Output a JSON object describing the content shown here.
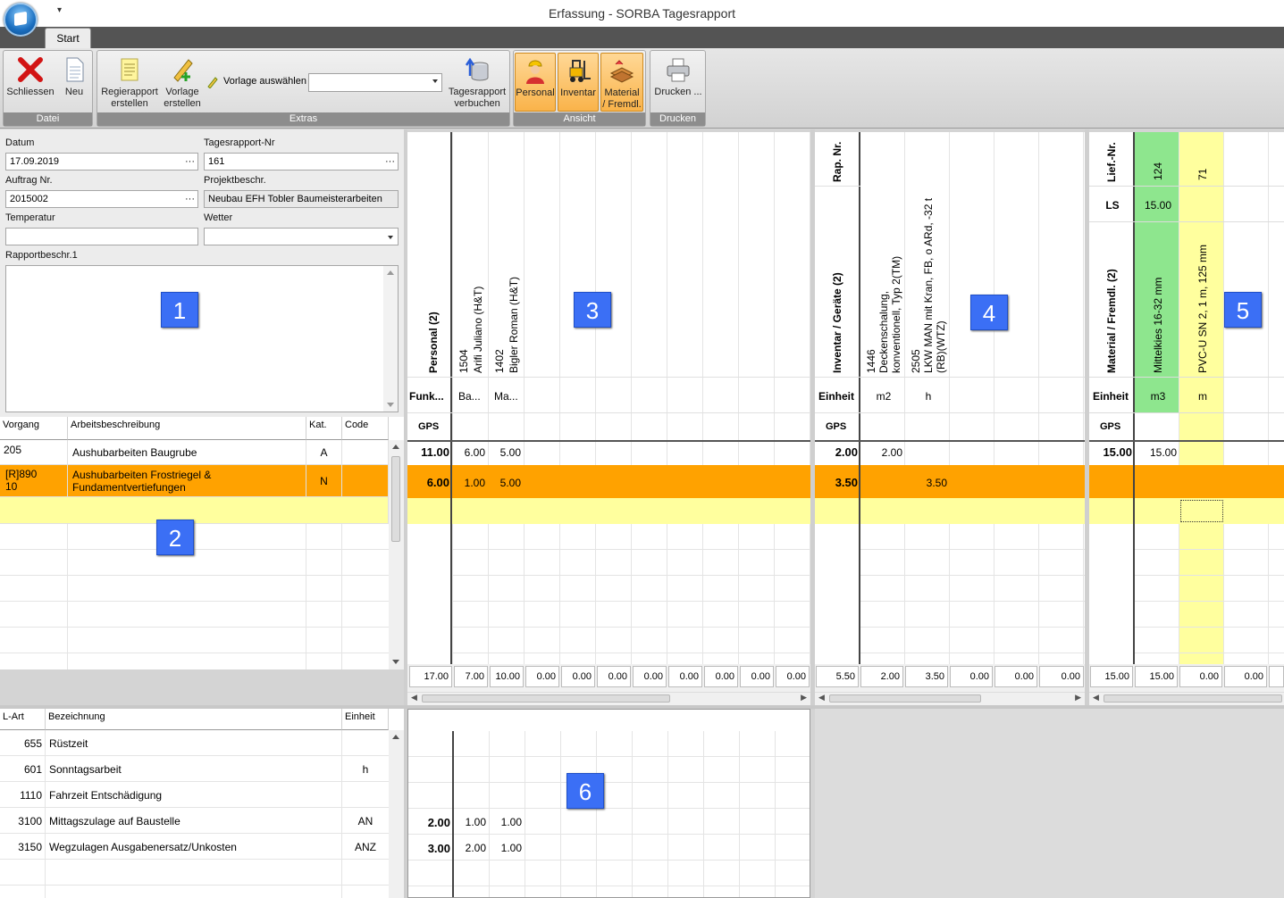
{
  "window": {
    "title": "Erfassung - SORBA Tagesrapport",
    "quick_access": "▾"
  },
  "tabs": [
    {
      "label": "Start"
    }
  ],
  "ribbon": {
    "groups": {
      "datei": "Datei",
      "extras": "Extras",
      "ansicht": "Ansicht",
      "drucken": "Drucken"
    },
    "buttons": {
      "schliessen": "Schliessen",
      "neu": "Neu",
      "regierapport_1": "Regierapport",
      "regierapport_2": "erstellen",
      "vorlage_1": "Vorlage",
      "vorlage_2": "erstellen",
      "vorlage_auswaehlen": "Vorlage auswählen",
      "tagesrapport_1": "Tagesrapport",
      "tagesrapport_2": "verbuchen",
      "personal": "Personal",
      "inventar": "Inventar",
      "material_1": "Material",
      "material_2": "/ Fremdl.",
      "drucken": "Drucken ..."
    },
    "vorlage_value": ""
  },
  "form": {
    "datum_label": "Datum",
    "datum_value": "17.09.2019",
    "nr_label": "Tagesrapport-Nr",
    "nr_value": "161",
    "auftrag_label": "Auftrag Nr.",
    "auftrag_value": "2015002",
    "projekt_label": "Projektbeschr.",
    "projekt_value": "Neubau EFH Tobler Baumeisterarbeiten",
    "temp_label": "Temperatur",
    "temp_value": "",
    "wetter_label": "Wetter",
    "wetter_value": "",
    "rapport_label": "Rapportbeschr.1",
    "rapport_value": ""
  },
  "badges": [
    "1",
    "2",
    "3",
    "4",
    "5",
    "6"
  ],
  "vorgang": {
    "headers": [
      "Vorgang",
      "Arbeitsbeschreibung",
      "Kat.",
      "Code"
    ],
    "rows": [
      {
        "vorgang": "205",
        "beschr": "Aushubarbeiten Baugrube",
        "kat": "A",
        "code": ""
      },
      {
        "vorgang_1": "[R]890",
        "vorgang_2": "10",
        "beschr_1": "Aushubarbeiten Frostriegel &",
        "beschr_2": "Fundamentvertiefungen",
        "kat": "N",
        "code": ""
      }
    ]
  },
  "personal": {
    "header": "Personal (2)",
    "funk_label": "Funk...",
    "gps_label": "GPS",
    "columns": [
      {
        "nr": "1504",
        "name": "Arifi Juliano (H&T)",
        "funk": "Ba..."
      },
      {
        "nr": "1402",
        "name": "Bigler Roman (H&T)",
        "funk": "Ma..."
      }
    ],
    "row_totals": [
      "11.00",
      "6.00"
    ],
    "row_values": [
      [
        "6.00",
        "5.00"
      ],
      [
        "1.00",
        "5.00"
      ]
    ],
    "sums": [
      "17.00",
      "7.00",
      "10.00",
      "0.00",
      "0.00",
      "0.00",
      "0.00",
      "0.00",
      "0.00",
      "0.00"
    ]
  },
  "inventar": {
    "rap_label": "Rap. Nr.",
    "header": "Inventar / Geräte (2)",
    "einheit_label": "Einheit",
    "gps_label": "GPS",
    "columns": [
      {
        "nr": "1446",
        "name_1": "Deckenschalung,",
        "name_2": "konventionell, Typ 2(TM)",
        "einheit": "m2"
      },
      {
        "nr": "2505",
        "name_1": "LKW MAN mit Kran, FB, o ARd, -32 t",
        "name_2": "(RB)(WTZ)",
        "einheit": "h"
      }
    ],
    "row_totals": [
      "2.00",
      "3.50"
    ],
    "row_values": [
      [
        "2.00",
        ""
      ],
      [
        "",
        "3.50"
      ]
    ],
    "sums": [
      "5.50",
      "2.00",
      "3.50",
      "0.00",
      "0.00",
      "0.00"
    ]
  },
  "material": {
    "lief_label": "Lief.-Nr.",
    "ls_label": "LS",
    "header": "Material / Fremdl. (2)",
    "einheit_label": "Einheit",
    "gps_label": "GPS",
    "columns": [
      {
        "lief": "124",
        "ls": "15.00",
        "name": "Mittelkies 16-32 mm",
        "einheit": "m3"
      },
      {
        "lief": "71",
        "ls": "",
        "name": "PVC-U SN 2, 1 m, 125 mm",
        "einheit": "m"
      }
    ],
    "row_totals": [
      "15.00",
      ""
    ],
    "row_values": [
      [
        "15.00",
        ""
      ],
      [
        "",
        ""
      ]
    ],
    "sums": [
      "15.00",
      "15.00",
      "0.00",
      "0.00"
    ]
  },
  "lohnart": {
    "headers": [
      "L-Art",
      "Bezeichnung",
      "Einheit"
    ],
    "rows": [
      {
        "nr": "655",
        "bez": "Rüstzeit",
        "einheit": ""
      },
      {
        "nr": "601",
        "bez": "Sonntagsarbeit",
        "einheit": "h"
      },
      {
        "nr": "1110",
        "bez": "Fahrzeit Entschädigung",
        "einheit": ""
      },
      {
        "nr": "3100",
        "bez": "Mittagszulage auf Baustelle",
        "einheit": "AN"
      },
      {
        "nr": "3150",
        "bez": "Wegzulagen Ausgabenersatz/Unkosten",
        "einheit": "ANZ"
      }
    ],
    "grid_totals": [
      "2.00",
      "3.00"
    ],
    "grid_values": [
      [
        "1.00",
        "1.00"
      ],
      [
        "2.00",
        "1.00"
      ]
    ]
  },
  "colors": {
    "orange": "#ffa200",
    "yellow": "#ffff9e",
    "green": "#8ee68e",
    "badge": "#3b6ff5"
  }
}
